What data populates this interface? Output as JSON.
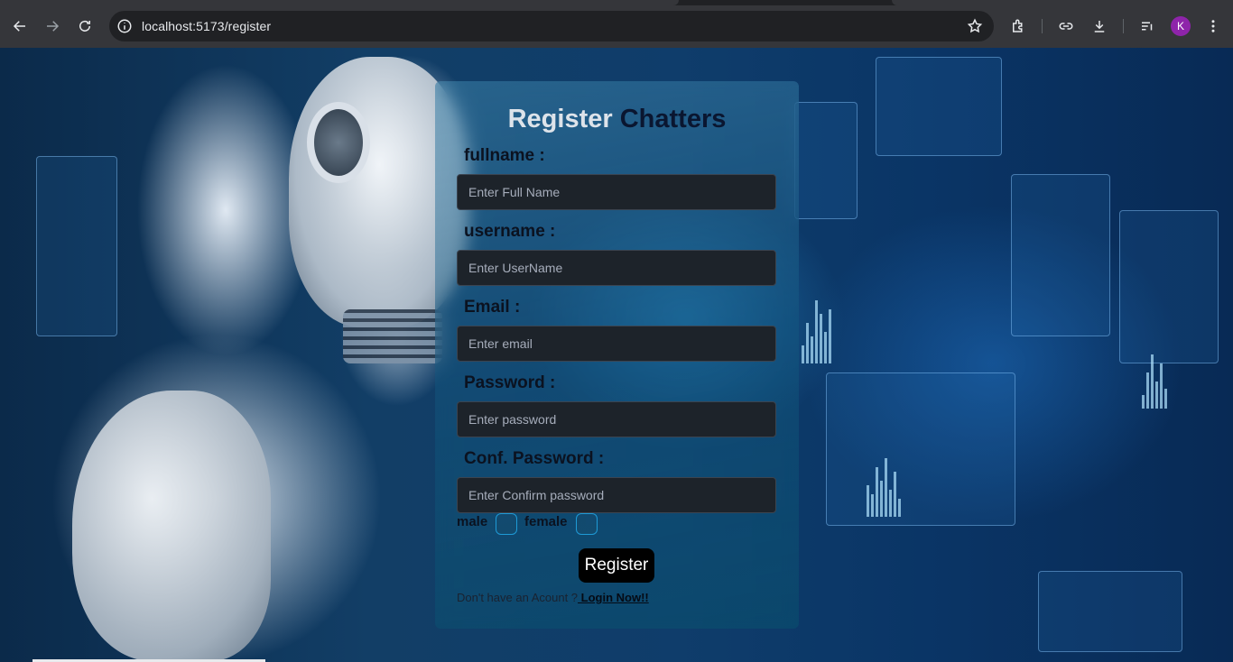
{
  "browser": {
    "url": "localhost:5173/register",
    "profile_initial": "K",
    "icons": [
      "back-arrow-icon",
      "forward-arrow-icon",
      "reload-icon",
      "site-info-icon",
      "bookmark-star-icon",
      "extensions-icon",
      "link-icon",
      "download-icon",
      "reading-list-icon",
      "more-vert-icon"
    ]
  },
  "form": {
    "title_part1": "Register",
    "title_part2": "Chatters",
    "fields": [
      {
        "label": "fullname :",
        "placeholder": "Enter Full Name"
      },
      {
        "label": "username :",
        "placeholder": "Enter UserName"
      },
      {
        "label": "Email :",
        "placeholder": "Enter email"
      },
      {
        "label": "Password :",
        "placeholder": "Enter password"
      },
      {
        "label": "Conf. Password :",
        "placeholder": "Enter Confirm password"
      }
    ],
    "gender_male": "male",
    "gender_female": "female",
    "submit_label": "Register",
    "login_prompt": "Don't have an Acount ?",
    "login_link": " Login Now!!"
  },
  "colors": {
    "accent_checkbox": "#1e9ad6",
    "button_bg": "#000000",
    "input_bg": "#1d232a"
  }
}
